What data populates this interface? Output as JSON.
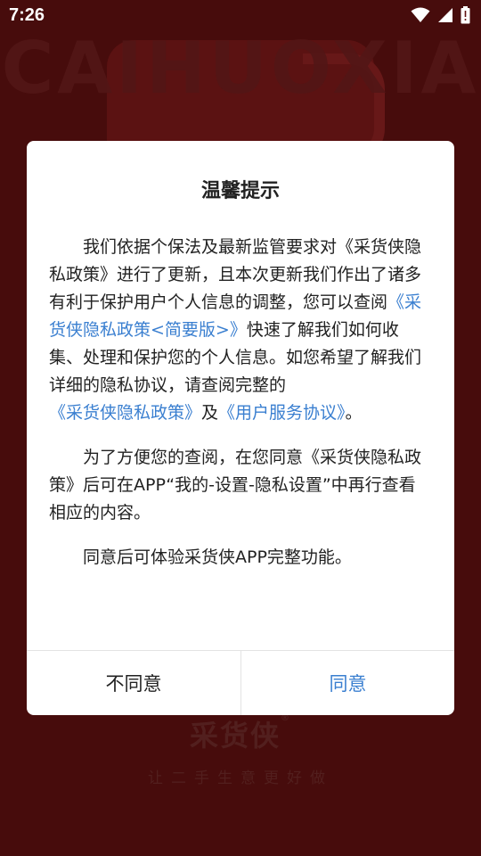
{
  "status_bar": {
    "time": "7:26",
    "icons": [
      "wifi-icon",
      "signal-icon",
      "battery-icon"
    ]
  },
  "background": {
    "brand_letters": "CAIHUOXIA",
    "logo_text": "采货侠",
    "logo_mark": "®",
    "slogan": "让二手生意更好做"
  },
  "dialog": {
    "title": "温馨提示",
    "p1": {
      "t1": "我们依据个保法及最新监管要求对《采货侠隐私政策》进行了更新，且本次更新我们作出了诸多有利于保护用户个人信息的调整，您可以查阅",
      "link1": "《采货侠隐私政策<简要版>》",
      "t2": "快速了解我们如何收集、处理和保护您的个人信息。如您希望了解我们详细的隐私协议，请查阅完整的",
      "link2": "《采货侠隐私政策》",
      "t3": "及",
      "link3": "《用户服务协议》",
      "t4": "。"
    },
    "p2": "为了方便您的查阅，在您同意《采货侠隐私政策》后可在APP“我的-设置-隐私设置”中再行查看相应的内容。",
    "p3": "同意后可体验采货侠APP完整功能。",
    "buttons": {
      "disagree": "不同意",
      "agree": "同意"
    }
  },
  "colors": {
    "link": "#3a7fd0",
    "background": "#5f1010",
    "text": "#222222"
  }
}
